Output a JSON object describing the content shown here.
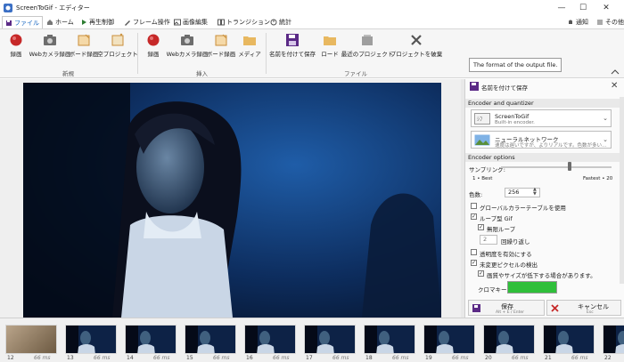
{
  "window": {
    "title": "ScreenToGif - エディター",
    "notify_label": "通知",
    "other_label": "その他"
  },
  "tabs": [
    {
      "label": "ファイル",
      "icon": "file-icon"
    },
    {
      "label": "ホーム",
      "icon": "home-icon"
    },
    {
      "label": "再生制御",
      "icon": "play-icon"
    },
    {
      "label": "フレーム操作",
      "icon": "frame-edit-icon"
    },
    {
      "label": "画像編集",
      "icon": "image-edit-icon"
    },
    {
      "label": "トランジション",
      "icon": "transition-icon"
    },
    {
      "label": "統計",
      "icon": "stats-icon"
    }
  ],
  "ribbon": {
    "groups": [
      {
        "label": "新規",
        "buttons": [
          "録画",
          "Webカメラ録画",
          "ボード録画",
          "空プロジェクト"
        ]
      },
      {
        "label": "挿入",
        "buttons": [
          "録画",
          "Webカメラ録画",
          "ボード録画",
          "メディア"
        ]
      },
      {
        "label": "ファイル",
        "buttons": [
          "名前を付けて保存",
          "ロード",
          "最近のプロジェクト",
          "プロジェクトを破棄"
        ]
      }
    ],
    "tooltip": "The format of the output file."
  },
  "panel": {
    "title": "名前を付けて保存",
    "encoder_section": "Encoder and quantizer",
    "encoder": {
      "name": "ScreenToGif",
      "desc": "Built-in encoder."
    },
    "quantizer": {
      "name": "ニューラルネットワーク",
      "desc": "速度は遅いですが、よりリアルです。色数が多い..."
    },
    "options_section": "Encoder options",
    "sampling_label": "サンプリング:",
    "sampling_value": 0.62,
    "sampling_min": "1 • Best",
    "sampling_max": "Fastest • 20",
    "colors_label": "色数:",
    "colors_value": "256",
    "global_palette": "グローバルカラーテーブルを使用",
    "loop_gif": "ループ型 Gif",
    "infinite_loop": "無限ループ",
    "repeat_value": "2",
    "repeat_label": "回繰り返し",
    "transparency": "透明度を有効にする",
    "detect_unchanged": "未変更ピクセルの検出",
    "quality_warning": "画質やサイズが低下する場合があります。",
    "chroma_label": "クロマキー:",
    "chroma_color": "#2fbf3a",
    "save_label": "保存",
    "save_shortcut": "Alt + E / Enter",
    "cancel_label": "キャンセル",
    "cancel_shortcut": "Esc"
  },
  "filmstrip": {
    "frames": [
      {
        "num": "12",
        "ms": "66 ms"
      },
      {
        "num": "13",
        "ms": "66 ms"
      },
      {
        "num": "14",
        "ms": "66 ms"
      },
      {
        "num": "15",
        "ms": "66 ms"
      },
      {
        "num": "16",
        "ms": "66 ms"
      },
      {
        "num": "17",
        "ms": "66 ms"
      },
      {
        "num": "18",
        "ms": "66 ms"
      },
      {
        "num": "19",
        "ms": "66 ms"
      },
      {
        "num": "20",
        "ms": "66 ms"
      },
      {
        "num": "21",
        "ms": "66 ms"
      },
      {
        "num": "22",
        "ms": ""
      }
    ]
  },
  "colors": {
    "accent": "#1565c0",
    "record_red": "#c62828",
    "save_purple": "#5b2a86"
  }
}
